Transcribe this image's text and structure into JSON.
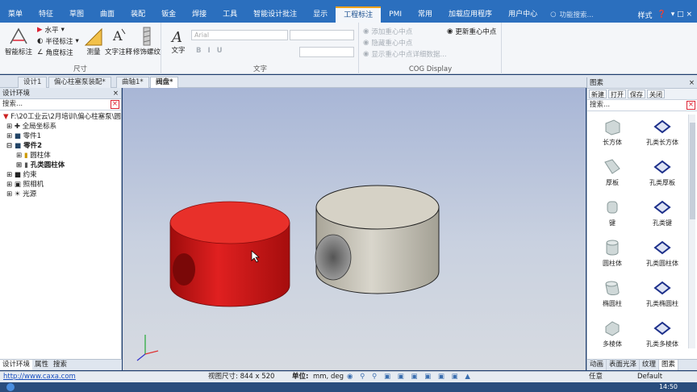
{
  "menu": {
    "items": [
      "菜单",
      "特征",
      "草图",
      "曲面",
      "装配",
      "钣金",
      "焊接",
      "工具",
      "智能设计批注",
      "显示",
      "工程标注",
      "PMI",
      "常用",
      "加载应用程序",
      "用户中心"
    ],
    "search_placeholder": "功能搜索...",
    "style_label": "样式"
  },
  "ribbon": {
    "smart_dim": "智能标注",
    "horizontal": "水平",
    "radius": "半径标注",
    "angle": "角度标注",
    "measure": "测量",
    "text_note": "文字注释",
    "thread": "修饰螺纹",
    "dim_group": "尺寸",
    "text_btn": "文字",
    "font_name": "Arial",
    "text_group": "文字",
    "cog_add": "添加重心中点",
    "cog_hide": "隐藏重心中点",
    "cog_show": "显示重心中点详细数据...",
    "cog_update": "更新重心中点",
    "cog_group": "COG Display"
  },
  "docs": {
    "tabs": [
      "设计1",
      "偏心柱塞泵装配*",
      "曲轴1*",
      "阀盘*"
    ]
  },
  "left": {
    "title": "设计环境",
    "search": "搜索...",
    "path": "F:\\20工业云\\2月培训\\偏心柱塞泵\\圆",
    "items": [
      "全局坐标系",
      "零件1",
      "零件2",
      "圆柱体",
      "孔类圆柱体",
      "约束",
      "照相机",
      "光源"
    ],
    "tabs": [
      "设计环境",
      "属性",
      "搜索"
    ]
  },
  "right": {
    "title": "图素",
    "buttons": [
      "新建",
      "打开",
      "保存",
      "关闭"
    ],
    "search": "搜索...",
    "items": [
      "长方体",
      "孔类长方体",
      "厚板",
      "孔类厚板",
      "键",
      "孔类键",
      "圆柱体",
      "孔类圆柱体",
      "椭圆柱",
      "孔类椭圆柱",
      "多棱体",
      "孔类多棱体"
    ],
    "tabs": [
      "动画",
      "表面光泽",
      "纹理",
      "图素"
    ]
  },
  "status": {
    "url": "http://www.caxa.com",
    "view_size": "视图尺寸: 844 x 520",
    "unit_label": "单位:",
    "unit_value": "mm, deg",
    "mode": "任意",
    "style": "Default"
  },
  "taskbar": {
    "clock": "14:50"
  },
  "colors": {
    "accent": "#2b6fbe",
    "red_part": "#d21a1a",
    "beige_part": "#cfcbbf"
  }
}
